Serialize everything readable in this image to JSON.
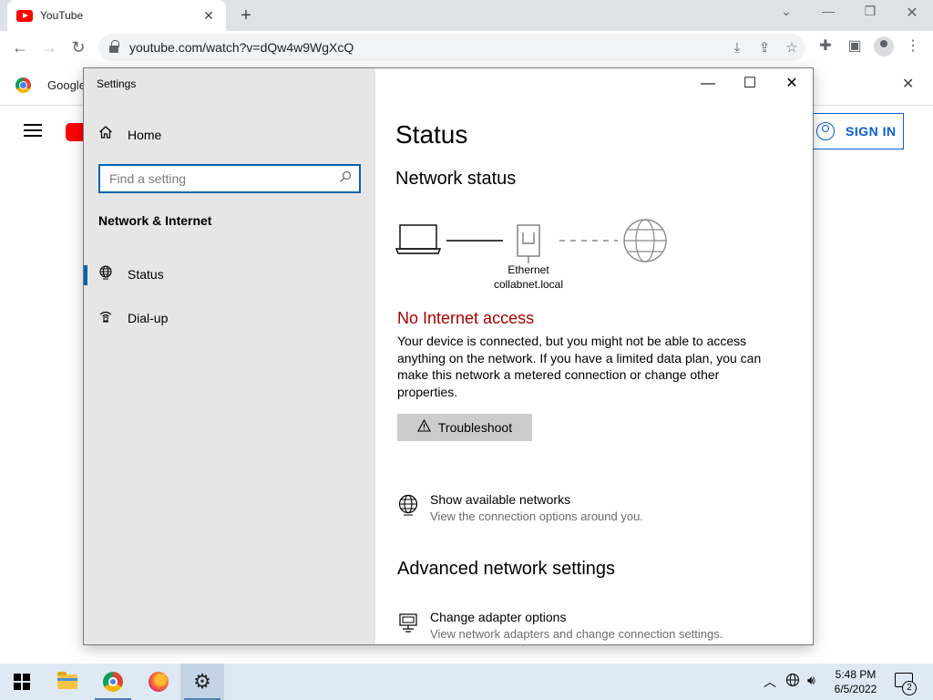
{
  "browser": {
    "tab_title": "YouTube",
    "url": "youtube.com/watch?v=dQw4w9WgXcQ",
    "bookmark_label": "Google",
    "youtube_signin_label": "SIGN IN"
  },
  "settings": {
    "app_title": "Settings",
    "home_label": "Home",
    "search_placeholder": "Find a setting",
    "section_title": "Network & Internet",
    "nav_items": [
      {
        "label": "Status",
        "icon": "globe-icon",
        "active": true
      },
      {
        "label": "Dial-up",
        "icon": "dialup-icon",
        "active": false
      }
    ],
    "page_title": "Status",
    "network_status_heading": "Network status",
    "diagram": {
      "adapter_name": "Ethernet",
      "network_name": "collabnet.local"
    },
    "error_title": "No Internet access",
    "error_text": "Your device is connected, but you might not be able to access anything on the network. If you have a limited data plan, you can make this network a metered connection or change other properties.",
    "troubleshoot_label": "Troubleshoot",
    "show_networks": {
      "title": "Show available networks",
      "subtitle": "View the connection options around you."
    },
    "advanced_heading": "Advanced network settings",
    "adapter_options": {
      "title": "Change adapter options",
      "subtitle": "View network adapters and change connection settings."
    }
  },
  "taskbar": {
    "time": "5:48 PM",
    "date": "6/5/2022",
    "notification_count": "2"
  },
  "colors": {
    "accent": "#0063b1",
    "error": "#a80000",
    "sidebar_bg": "#e6e6e6",
    "youtube_red": "#ff0000",
    "taskbar_bg": "#dfe9f3"
  }
}
